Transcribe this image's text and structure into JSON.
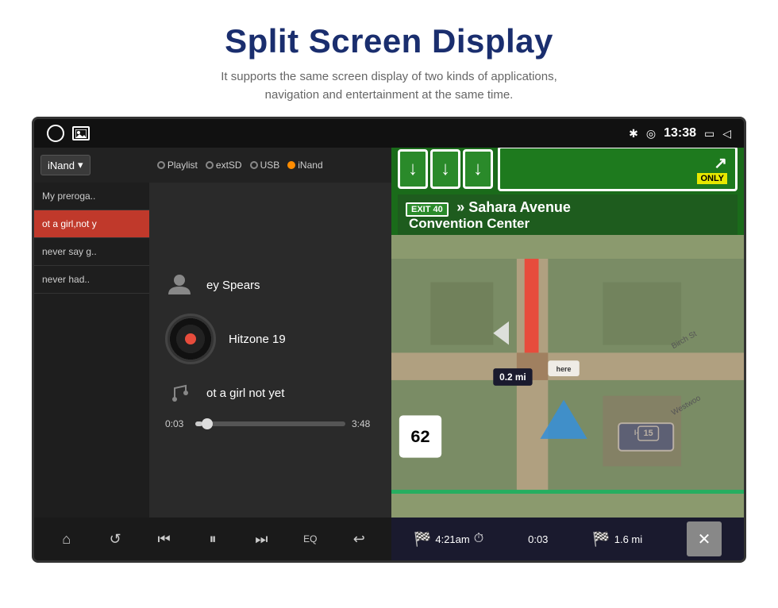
{
  "header": {
    "title": "Split Screen Display",
    "subtitle": "It supports the same screen display of two kinds of applications,\nnavigation and entertainment at the same time."
  },
  "statusBar": {
    "time": "13:38",
    "bluetooth": "✱",
    "location": "◎"
  },
  "musicPanel": {
    "sourceDropdown": "iNand",
    "sources": [
      "Playlist",
      "extSD",
      "USB",
      "iNand"
    ],
    "playlist": [
      {
        "label": "My preroga..",
        "active": false
      },
      {
        "label": "ot a girl,not y",
        "active": true
      },
      {
        "label": "never say g..",
        "active": false
      },
      {
        "label": "never had..",
        "active": false
      }
    ],
    "currentArtist": "ey Spears",
    "currentAlbum": "Hitzone 19",
    "currentTrack": "ot a girl not yet",
    "timeElapsed": "0:03",
    "timeTotal": "3:48",
    "controls": {
      "home": "⌂",
      "repeat": "↺",
      "prev": "⏮",
      "play": "⏸",
      "next": "⏭",
      "eq": "EQ",
      "back": "↩"
    }
  },
  "navPanel": {
    "highwaySigns": {
      "mainText": "Sahara Avenue",
      "subText": "Convention Center",
      "exitNum": "EXIT 40",
      "exitLabel": "» Sahara Avenue",
      "only": "ONLY"
    },
    "mapInfo": {
      "distance": "0.2 mi",
      "speed": "62",
      "highway": "I-15",
      "shieldNum": "15"
    },
    "bottomBar": {
      "arrivalTime": "4:21am",
      "elapsed": "0:03",
      "remaining": "1.6 mi"
    },
    "closeBtn": "✕"
  }
}
